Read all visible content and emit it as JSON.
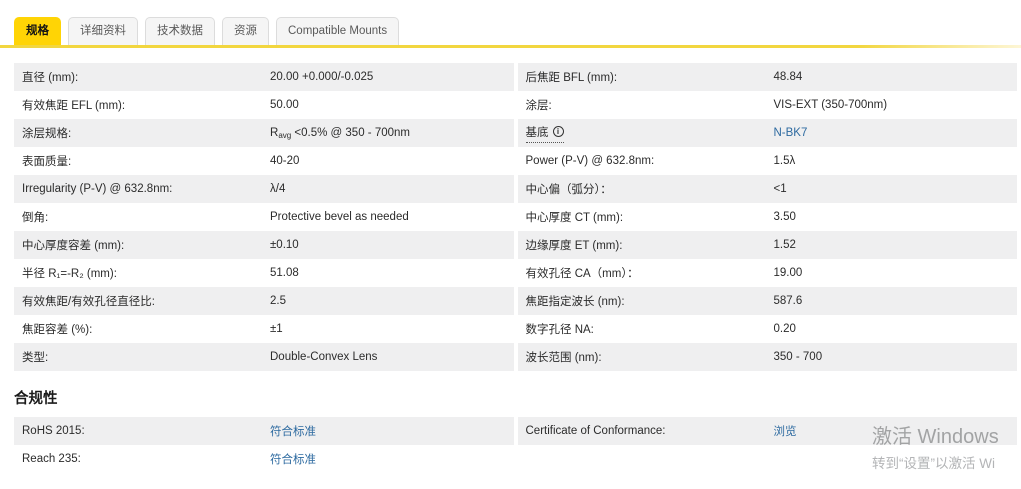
{
  "tabs": [
    {
      "label": "规格",
      "active": true
    },
    {
      "label": "详细资料",
      "active": false
    },
    {
      "label": "技术数据",
      "active": false
    },
    {
      "label": "资源",
      "active": false
    },
    {
      "label": "Compatible Mounts",
      "active": false
    }
  ],
  "icons": {
    "info": "i"
  },
  "specs": {
    "left": [
      {
        "label": "直径 (mm):",
        "value": "20.00 +0.000/-0.025"
      },
      {
        "label": "有效焦距 EFL (mm):",
        "value": "50.00"
      },
      {
        "label": "涂层规格:",
        "value_html": "R<sub>avg</sub> &lt;0.5% @ 350 - 700nm"
      },
      {
        "label": "表面质量:",
        "value": "40-20"
      },
      {
        "label": "Irregularity (P-V) @ 632.8nm:",
        "value": "λ/4"
      },
      {
        "label": "倒角:",
        "value": "Protective bevel as needed"
      },
      {
        "label": "中心厚度容差 (mm):",
        "value": "±0.10"
      },
      {
        "label": "半径 R₁=-R₂ (mm):",
        "value": "51.08"
      },
      {
        "label": "有效焦距/有效孔径直径比:",
        "value": "2.5"
      },
      {
        "label": "焦距容差 (%):",
        "value": "±1"
      },
      {
        "label": "类型:",
        "value": "Double-Convex Lens"
      }
    ],
    "right": [
      {
        "label": "后焦距 BFL (mm):",
        "value": "48.84"
      },
      {
        "label": "涂层:",
        "value": "VIS-EXT (350-700nm)"
      },
      {
        "label": "基底",
        "value": "N-BK7",
        "link": true,
        "info": true
      },
      {
        "label": "Power (P-V) @ 632.8nm:",
        "value": "1.5λ"
      },
      {
        "label": "中心偏（弧分）：",
        "value": "<1"
      },
      {
        "label": "中心厚度 CT (mm):",
        "value": "3.50"
      },
      {
        "label": "边缘厚度 ET (mm):",
        "value": "1.52"
      },
      {
        "label": "有效孔径 CA（mm）：",
        "value": "19.00"
      },
      {
        "label": "焦距指定波长 (nm):",
        "value": "587.6"
      },
      {
        "label": "数字孔径 NA:",
        "value": "0.20"
      },
      {
        "label": "波长范围 (nm):",
        "value": "350 - 700"
      }
    ]
  },
  "compliance": {
    "heading": "合规性",
    "left": [
      {
        "label": "RoHS 2015:",
        "value": "符合标准",
        "link": true
      },
      {
        "label": "Reach 235:",
        "value": "符合标准",
        "link": true
      }
    ],
    "right": [
      {
        "label": "Certificate of Conformance:",
        "value": "浏览",
        "link": true
      }
    ]
  },
  "watermark": {
    "line1": "激活 Windows",
    "line2": "转到“设置”以激活 Wi"
  },
  "colors": {
    "accent": "#ffd405",
    "link": "#2d6aa0",
    "row_alt": "#efeff0"
  }
}
